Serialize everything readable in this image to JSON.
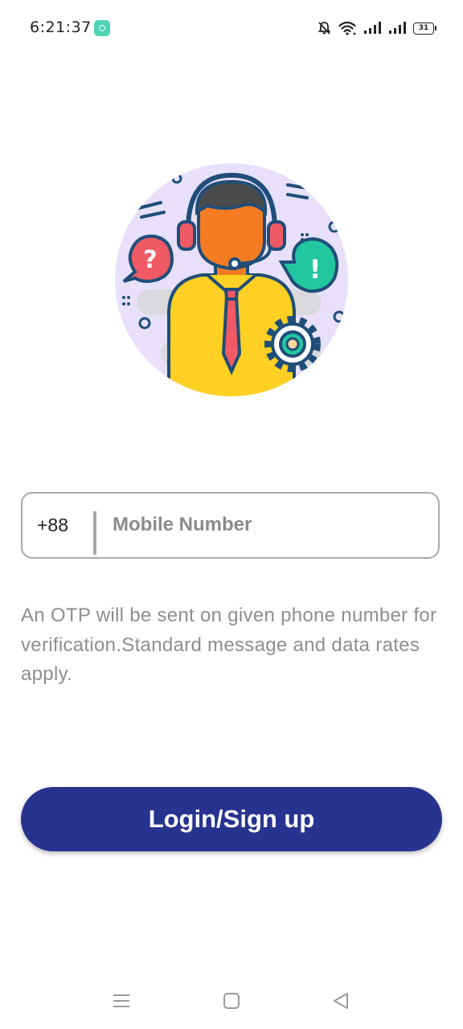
{
  "status_bar": {
    "time": "6:21:37",
    "battery": "31",
    "icons": [
      "app-notification-icon",
      "mute-bell-icon",
      "wifi-icon",
      "signal-icon",
      "signal-icon",
      "battery-icon"
    ]
  },
  "illustration": {
    "subject": "customer-support-agent-illustration",
    "colors": {
      "background_circle": "#e8e0fb",
      "skin": "#f57c22",
      "hair": "#4a4a4a",
      "shirt": "#fdd023",
      "tie": "#f05a64",
      "question_bubble": "#f05a64",
      "exclamation_bubble": "#22c7a0",
      "outline": "#1f4e79"
    }
  },
  "login_form": {
    "country_code": "+88",
    "mobile_placeholder": "Mobile Number",
    "mobile_value": "",
    "info_text": "An OTP will be sent on given phone number for verification.Standard message and data rates apply.",
    "submit_label": "Login/Sign up"
  },
  "nav_bar": {
    "buttons": [
      "menu-icon",
      "home-square-icon",
      "back-triangle-icon"
    ]
  },
  "colors": {
    "primary": "#27338e",
    "field_border": "#a9a9a9",
    "info_text": "#8e8e8e"
  }
}
